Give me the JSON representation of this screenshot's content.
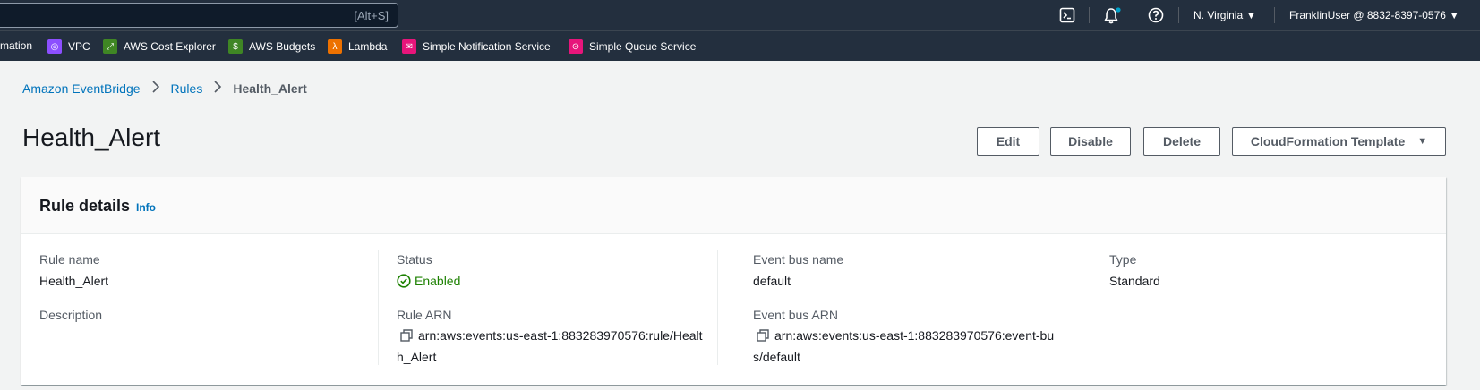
{
  "topnav": {
    "search_hint": "[Alt+S]",
    "icons": [
      "cloudshell-icon",
      "bell-icon",
      "help-icon"
    ],
    "region": "N. Virginia",
    "account": "FranklinUser @ 8832-8397-0576"
  },
  "favorites": [
    {
      "label": "mation",
      "icon": "",
      "color": ""
    },
    {
      "label": "VPC",
      "icon": "vpc-icon",
      "color": "#8c4fff"
    },
    {
      "label": "AWS Cost Explorer",
      "icon": "cost-explorer-icon",
      "color": "#3f8624"
    },
    {
      "label": "AWS Budgets",
      "icon": "budgets-icon",
      "color": "#3f8624"
    },
    {
      "label": "Lambda",
      "icon": "lambda-icon",
      "color": "#ed7100"
    },
    {
      "label": "Simple Notification Service",
      "icon": "sns-icon",
      "color": "#e7157b"
    },
    {
      "label": "Simple Queue Service",
      "icon": "sqs-icon",
      "color": "#e7157b"
    }
  ],
  "breadcrumb": {
    "items": [
      "Amazon EventBridge",
      "Rules"
    ],
    "current": "Health_Alert"
  },
  "page": {
    "title": "Health_Alert",
    "buttons": {
      "edit": "Edit",
      "disable": "Disable",
      "delete": "Delete",
      "cloudformation": "CloudFormation Template"
    }
  },
  "rule_details": {
    "title": "Rule details",
    "info": "Info",
    "rule_name_label": "Rule name",
    "rule_name": "Health_Alert",
    "description_label": "Description",
    "status_label": "Status",
    "status": "Enabled",
    "rule_arn_label": "Rule ARN",
    "rule_arn_line1": "arn:aws:events:us-east-1:883283970576:rule/Healt",
    "rule_arn_line2": "h_Alert",
    "event_bus_name_label": "Event bus name",
    "event_bus_name": "default",
    "event_bus_arn_label": "Event bus ARN",
    "event_bus_arn_line1": "arn:aws:events:us-east-1:883283970576:event-bu",
    "event_bus_arn_line2": "s/default",
    "type_label": "Type",
    "type": "Standard"
  },
  "colors": {
    "nav_bg": "#232f3e",
    "link": "#0073bb",
    "success": "#1d8102",
    "notification_dot": "#00a1c9"
  }
}
